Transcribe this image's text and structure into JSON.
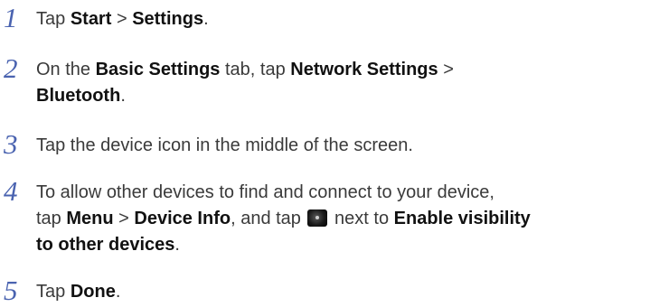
{
  "steps": [
    {
      "number": "1",
      "parts": [
        "Tap ",
        "Start",
        " > ",
        "Settings",
        "."
      ]
    },
    {
      "number": "2",
      "parts": [
        "On the ",
        "Basic Settings",
        " tab, tap ",
        "Network Settings",
        " >",
        "Bluetooth",
        "."
      ]
    },
    {
      "number": "3",
      "parts": [
        "Tap the device icon in the middle of the screen."
      ]
    },
    {
      "number": "4",
      "parts": [
        "To allow other devices to find and connect to your device,",
        "tap ",
        "Menu",
        " > ",
        "Device Info",
        ", and tap ",
        " next to ",
        "Enable visibility",
        "to other devices",
        "."
      ],
      "icon": "visibility-toggle-icon"
    },
    {
      "number": "5",
      "parts": [
        "Tap ",
        "Done",
        "."
      ]
    }
  ],
  "colors": {
    "step_number": "#4a63b0",
    "text": "#3a3a3a",
    "bold_text": "#111111"
  }
}
